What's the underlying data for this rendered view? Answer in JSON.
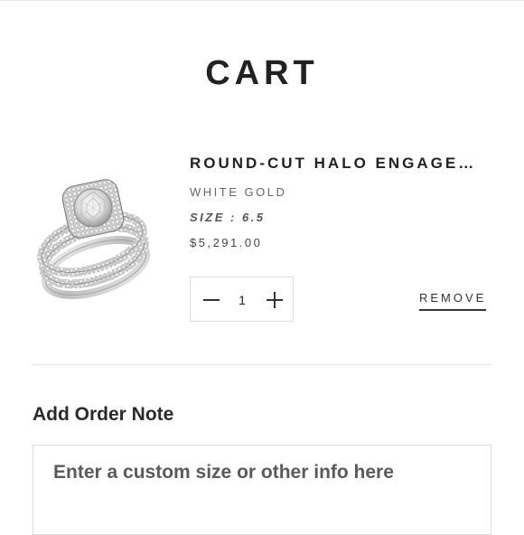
{
  "page": {
    "title": "CART"
  },
  "cart_item": {
    "title": "ROUND-CUT HALO ENGAGE…",
    "variant": "WHITE GOLD",
    "size": "SIZE : 6.5",
    "price": "$5,291.00",
    "quantity": "1",
    "remove_label": "REMOVE",
    "image_icon": "diamond-ring-image"
  },
  "order_note": {
    "heading": "Add Order Note",
    "placeholder": "Enter a custom size or other info here",
    "value": ""
  },
  "colors": {
    "text_primary": "#222222",
    "text_muted": "#666666",
    "border": "#dddddd",
    "background": "#ffffff"
  }
}
